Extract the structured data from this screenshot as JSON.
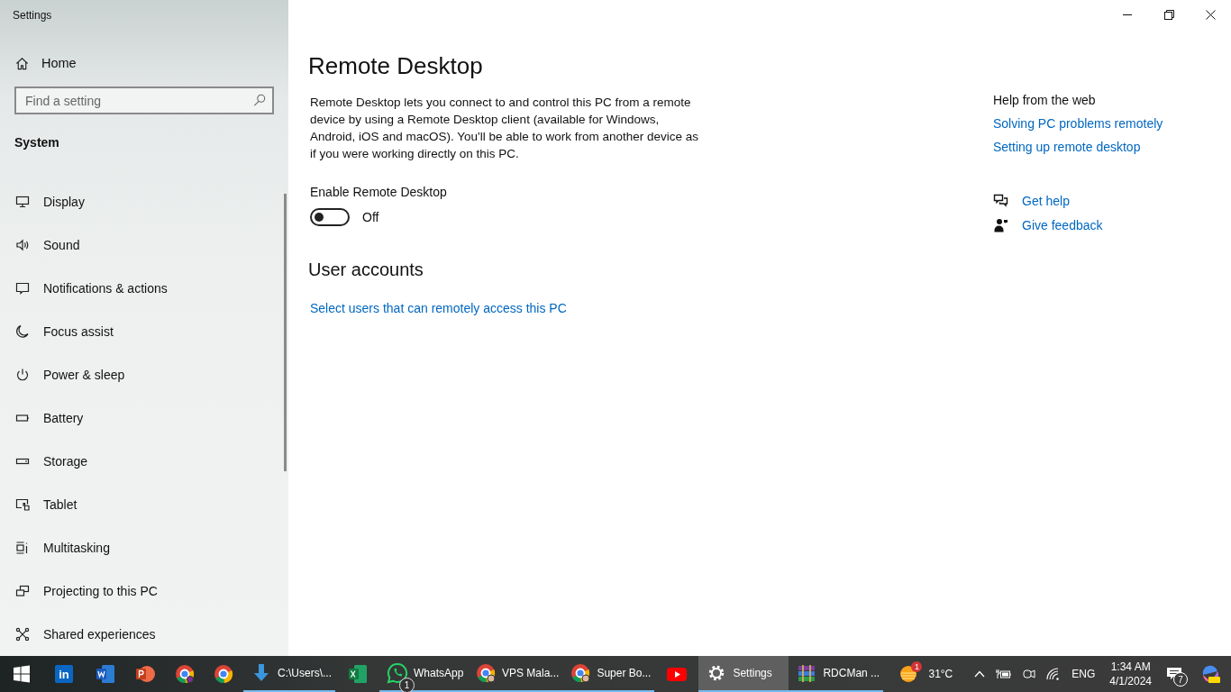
{
  "window": {
    "title": "Settings"
  },
  "sidebar": {
    "home": "Home",
    "search": {
      "placeholder": "Find a setting"
    },
    "section": "System",
    "items": [
      {
        "label": "Display"
      },
      {
        "label": "Sound"
      },
      {
        "label": "Notifications & actions"
      },
      {
        "label": "Focus assist"
      },
      {
        "label": "Power & sleep"
      },
      {
        "label": "Battery"
      },
      {
        "label": "Storage"
      },
      {
        "label": "Tablet"
      },
      {
        "label": "Multitasking"
      },
      {
        "label": "Projecting to this PC"
      },
      {
        "label": "Shared experiences"
      }
    ]
  },
  "main": {
    "title": "Remote Desktop",
    "description": "Remote Desktop lets you connect to and control this PC from a remote device by using a Remote Desktop client (available for Windows, Android, iOS and macOS). You'll be able to work from another device as if you were working directly on this PC.",
    "toggle": {
      "label": "Enable Remote Desktop",
      "on": false,
      "state_text": "Off"
    },
    "user_accounts": {
      "heading": "User accounts",
      "link": "Select users that can remotely access this PC"
    }
  },
  "help": {
    "heading": "Help from the web",
    "links": [
      "Solving PC problems remotely",
      "Setting up remote desktop"
    ],
    "actions": [
      "Get help",
      "Give feedback"
    ]
  },
  "taskbar": {
    "items": [
      {
        "running": false,
        "selected": false
      },
      {
        "logo_text": "in",
        "running": false,
        "selected": false
      },
      {
        "running": false,
        "selected": false
      },
      {
        "running": false,
        "selected": false
      },
      {
        "running": false,
        "selected": false
      },
      {
        "running": false,
        "selected": false
      },
      {
        "label": "C:\\Users\\...",
        "running": true,
        "selected": false
      },
      {
        "running": false,
        "selected": false
      },
      {
        "label": "WhatsApp",
        "badge": "1",
        "running": true,
        "selected": false
      },
      {
        "label": "VPS Mala...",
        "running": true,
        "selected": false
      },
      {
        "label": "Super Bo...",
        "running": true,
        "selected": false
      },
      {
        "running": false,
        "selected": false
      },
      {
        "label": "Settings",
        "running": true,
        "selected": true
      },
      {
        "label": "RDCMan ...",
        "running": true,
        "selected": false
      }
    ],
    "tray": {
      "weather_badge": "1",
      "temperature": "31°C",
      "language": "ENG",
      "time": "1:34 AM",
      "date": "4/1/2024",
      "notifications": "7"
    }
  }
}
